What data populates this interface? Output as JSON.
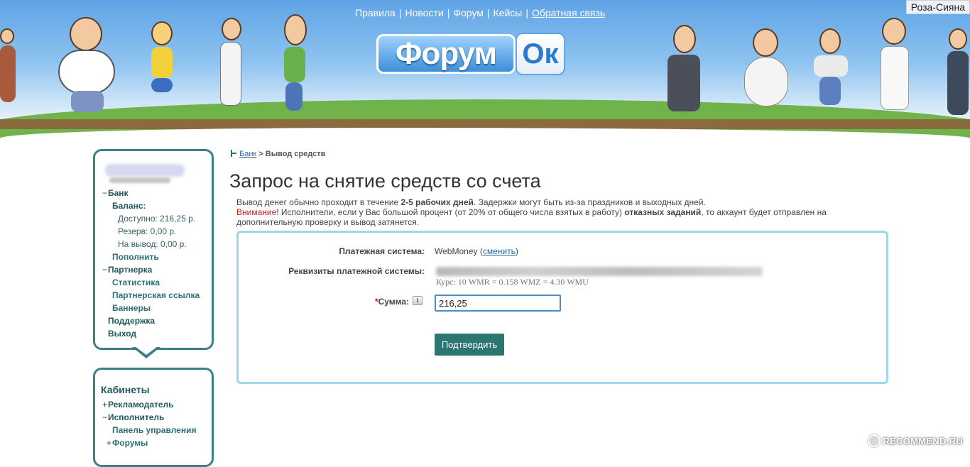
{
  "header": {
    "nav": [
      "Правила",
      "Новости",
      "Форум",
      "Кейсы",
      "Обратная связь"
    ],
    "logo_main": "Форум",
    "logo_accent": "Ок",
    "username": "Роза-Сияна"
  },
  "sidebar": {
    "profile": {
      "items": [
        {
          "marker": "−",
          "label": "Банк"
        },
        {
          "label": "Баланс:"
        },
        {
          "label": "Доступно: 216,25 р."
        },
        {
          "label": "Резерв: 0,00 р."
        },
        {
          "label": "На вывод: 0,00 р."
        },
        {
          "label": "Пополнить"
        },
        {
          "marker": "−",
          "label": "Партнерка"
        },
        {
          "label": "Статистика"
        },
        {
          "label": "Партнерская ссылка"
        },
        {
          "label": "Баннеры"
        },
        {
          "label": "Поддержка"
        },
        {
          "label": "Выход"
        }
      ]
    },
    "cabinets": {
      "title": "Кабинеты",
      "items": [
        {
          "marker": "+",
          "label": "Рекламодатель"
        },
        {
          "marker": "−",
          "label": "Исполнитель"
        },
        {
          "label": "Панель управления"
        },
        {
          "marker": "+",
          "label": "Форумы"
        }
      ]
    }
  },
  "breadcrumb": {
    "link": "Банк",
    "separator": " > ",
    "current": "Вывод средств"
  },
  "main": {
    "title": "Запрос на снятие средств со счета",
    "info_line1_before": "Вывод денег обычно проходит в течение ",
    "info_line1_bold": "2-5 рабочих дней",
    "info_line1_after": ". Задержки могут быть из-за праздников и выходных дней.",
    "warning_label": "Внимание",
    "info_line2_before": "! Исполнители, если у Вас большой процент (от 20% от общего числа взятых в работу) ",
    "info_line2_bold": "отказных заданий",
    "info_line2_after": ", то аккаунт будет отправлен на дополнительную проверку и вывод затянется."
  },
  "form": {
    "payment_system_label": "Платежная система:",
    "payment_system_value": "WebMoney",
    "change_link": "сменить",
    "requisites_label": "Реквизиты платежной системы:",
    "rate_text": "Курс: 10 WMR = 0.158 WMZ = 4.30 WMU",
    "amount_required_mark": "*",
    "amount_label": "Сумма:",
    "info_icon_text": "i",
    "amount_value": "216,25",
    "submit_label": "Подтвердить"
  },
  "watermark": "RECOMMEND.RU"
}
